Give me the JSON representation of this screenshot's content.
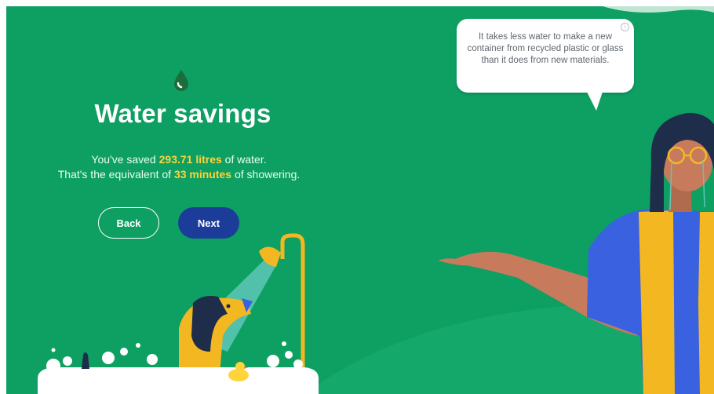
{
  "header": {
    "title": "Water savings"
  },
  "message": {
    "line1_prefix": "You've saved ",
    "line1_value": "293.71 litres",
    "line1_suffix": " of water.",
    "line2_prefix": "That's the equivalent of ",
    "line2_value": "33 minutes",
    "line2_suffix": " of showering."
  },
  "buttons": {
    "back_label": "Back",
    "next_label": "Next"
  },
  "tip": {
    "text": "It takes less water to make a new container from recycled plastic or glass than it does from new materials.",
    "info_glyph": "i"
  },
  "icons": {
    "drop": "water-drop-icon",
    "info": "info-icon"
  },
  "colors": {
    "background": "#0e9f63",
    "highlight": "#ffd33a",
    "next_button": "#1c3c9a",
    "bubble": "#ffffff"
  }
}
